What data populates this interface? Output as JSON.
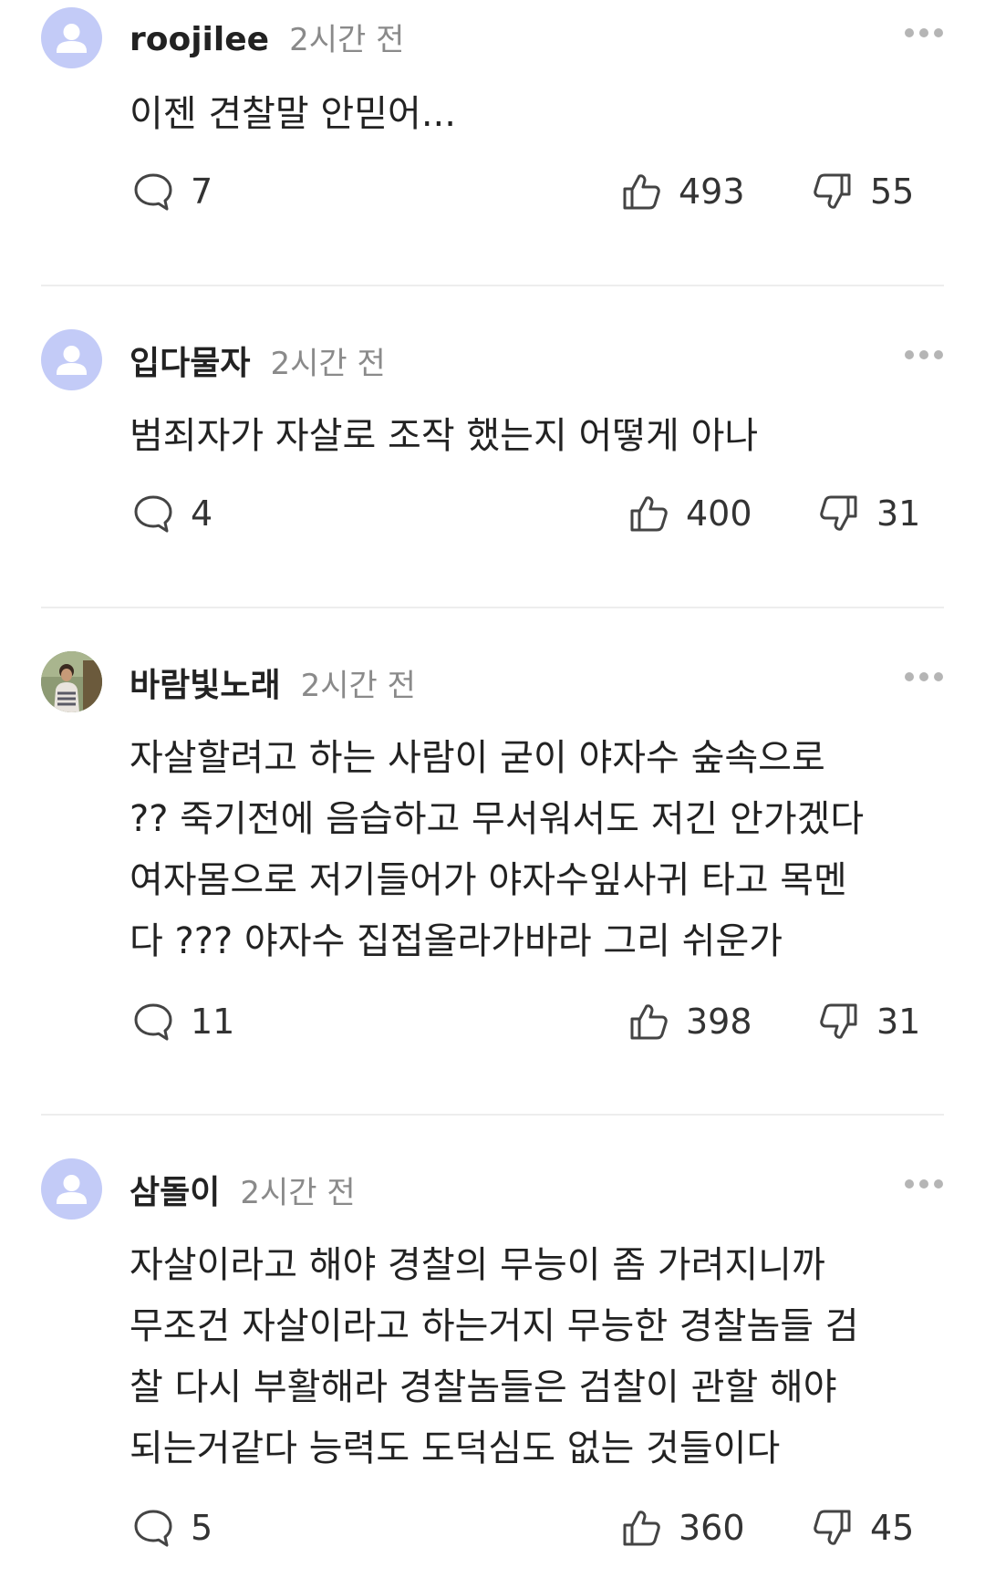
{
  "comments": [
    {
      "username": "roojilee",
      "time": "2시간 전",
      "text": "이젠 견찰말 안믿어...",
      "replies": "7",
      "likes": "493",
      "dislikes": "55",
      "avatar": "default-user-icon"
    },
    {
      "username": "입다물자",
      "time": "2시간 전",
      "text": "범죄자가 자살로 조작 했는지 어떻게 아나",
      "replies": "4",
      "likes": "400",
      "dislikes": "31",
      "avatar": "default-user-icon"
    },
    {
      "username": "바람빛노래",
      "time": "2시간 전",
      "text": "자살할려고 하는 사람이 굳이 야자수 숲속으로\n?? 죽기전에 음습하고 무서워서도 저긴 안가겠다\n여자몸으로 저기들어가 야자수잎사귀 타고 목멘\n다 ??? 야자수 집접올라가바라 그리 쉬운가",
      "replies": "11",
      "likes": "398",
      "dislikes": "31",
      "avatar": "user-photo"
    },
    {
      "username": "삼돌이",
      "time": "2시간 전",
      "text": "자살이라고 해야 경찰의 무능이 좀 가려지니까\n무조건 자살이라고 하는거지 무능한 경찰놈들 검\n찰 다시 부활해라 경찰놈들은 검찰이 관할 해야\n되는거같다 능력도 도덕심도 없는 것들이다",
      "replies": "5",
      "likes": "360",
      "dislikes": "45",
      "avatar": "default-user-icon"
    }
  ],
  "colors": {
    "avatar_bg": "#c3cbf7",
    "avatar_figure": "#ffffff",
    "text": "#222222",
    "muted": "#8a8a8a",
    "divider": "#ededed"
  }
}
